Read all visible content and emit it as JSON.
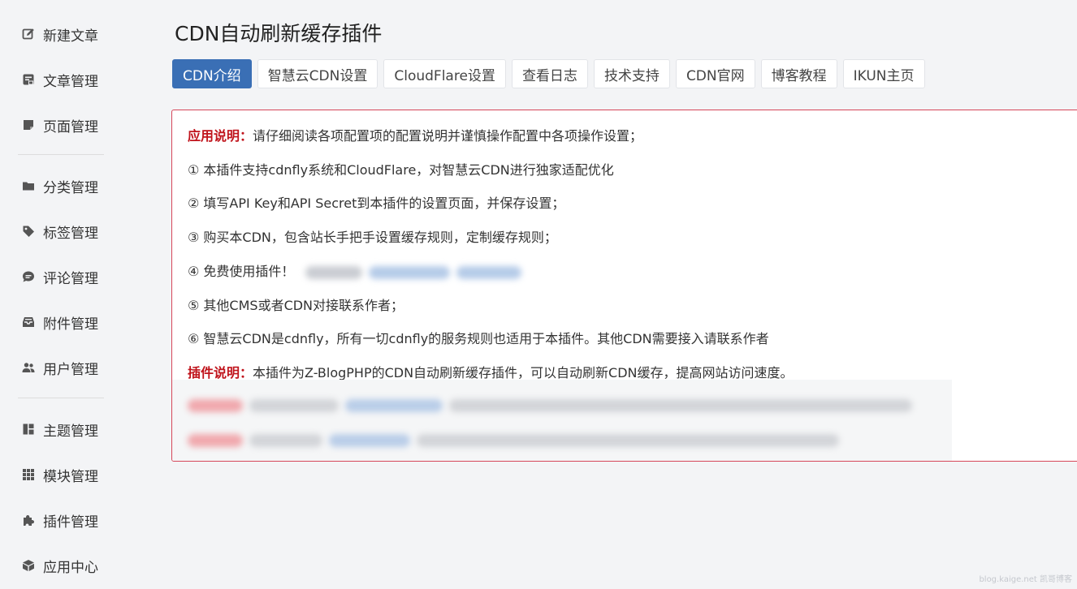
{
  "sidebar": {
    "items": [
      {
        "label": "新建文章",
        "icon": "edit-icon"
      },
      {
        "label": "文章管理",
        "icon": "article-icon"
      },
      {
        "label": "页面管理",
        "icon": "page-icon"
      },
      {
        "label": "分类管理",
        "icon": "folder-icon"
      },
      {
        "label": "标签管理",
        "icon": "tag-icon"
      },
      {
        "label": "评论管理",
        "icon": "comment-icon"
      },
      {
        "label": "附件管理",
        "icon": "inbox-icon"
      },
      {
        "label": "用户管理",
        "icon": "users-icon"
      },
      {
        "label": "主题管理",
        "icon": "layout-icon"
      },
      {
        "label": "模块管理",
        "icon": "grid-icon"
      },
      {
        "label": "插件管理",
        "icon": "puzzle-icon"
      },
      {
        "label": "应用中心",
        "icon": "box-icon"
      }
    ]
  },
  "main": {
    "title": "CDN自动刷新缓存插件",
    "tabs": [
      {
        "label": "CDN介绍",
        "active": true
      },
      {
        "label": "智慧云CDN设置",
        "active": false
      },
      {
        "label": "CloudFlare设置",
        "active": false
      },
      {
        "label": "查看日志",
        "active": false
      },
      {
        "label": "技术支持",
        "active": false
      },
      {
        "label": "CDN官网",
        "active": false
      },
      {
        "label": "博客教程",
        "active": false
      },
      {
        "label": "IKUN主页",
        "active": false
      }
    ],
    "panel": {
      "usage_label": "应用说明：",
      "usage_text": "请仔细阅读各项配置项的配置说明并谨慎操作配置中各项操作设置；",
      "items": [
        "① 本插件支持cdnfly系统和CloudFlare，对智慧云CDN进行独家适配优化",
        "② 填写API Key和API Secret到本插件的设置页面，并保存设置；",
        "③ 购买本CDN，包含站长手把手设置缓存规则，定制缓存规则；",
        "④ 免费使用插件！",
        "⑤ 其他CMS或者CDN对接联系作者；",
        "⑥ 智慧云CDN是cdnfly，所有一切cdnfly的服务规则也适用于本插件。其他CDN需要接入请联系作者"
      ],
      "plugin_label": "插件说明：",
      "plugin_text": "本插件为Z-BlogPHP的CDN自动刷新缓存插件，可以自动刷新CDN缓存，提高网站访问速度。"
    },
    "colors": {
      "accent": "#3a6fb5",
      "panel_border": "#d6475a",
      "label_red": "#c0141c"
    }
  },
  "watermark": "blog.kaige.net 凯哥博客"
}
